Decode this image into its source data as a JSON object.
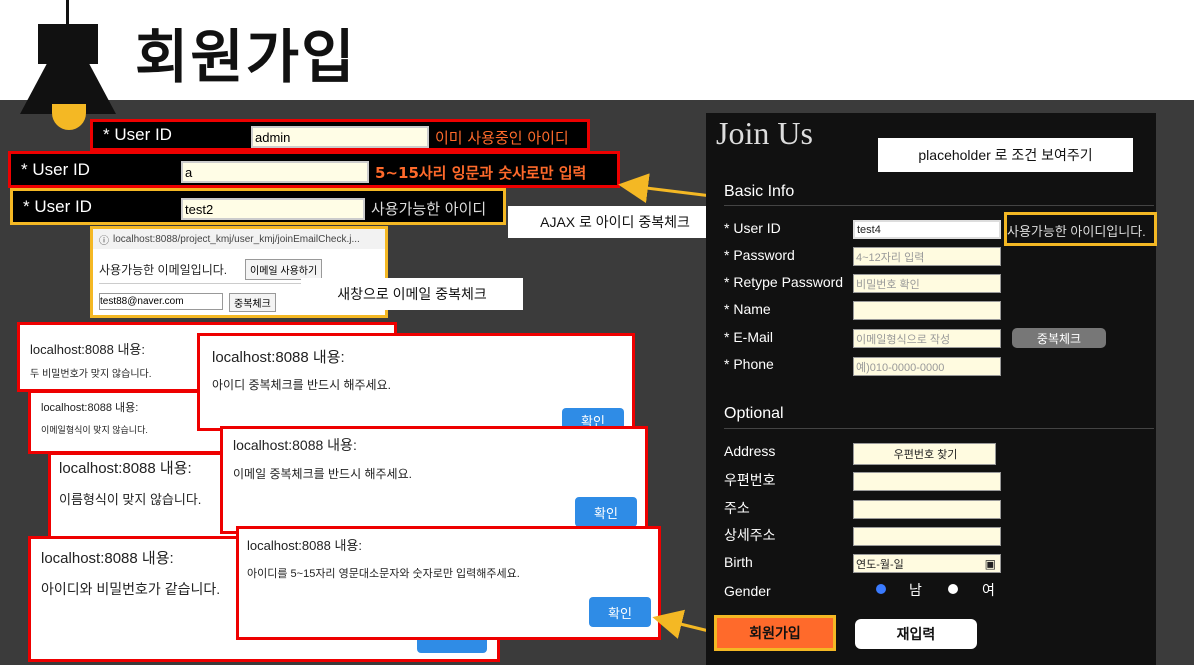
{
  "header": {
    "title": "회원가입"
  },
  "id_examples": [
    {
      "label": "* User ID",
      "value": "admin",
      "message": "이미 사용중인 아이디"
    },
    {
      "label": "* User ID",
      "value": "a",
      "message": "5~15사리 잉문과 숫사로만 입력"
    },
    {
      "label": "* User ID",
      "value": "test2",
      "message": "사용가능한 아이디"
    }
  ],
  "email_window": {
    "url": "localhost:8088/project_kmj/user_kmj/joinEmailCheck.j...",
    "status": "사용가능한 이메일입니다.",
    "use_button": "이메일 사용하기",
    "email_value": "test88@naver.com",
    "check_button": "중복체크"
  },
  "callouts": {
    "email_popup": "새창으로 이메일 중복체크",
    "ajax": "AJAX 로 아이디 중복체크",
    "placeholder": "placeholder 로 조건 보여주기"
  },
  "popups": [
    {
      "title": "localhost:8088 내용:",
      "message": "두 비밀번호가 맞지 않습니다."
    },
    {
      "title": "localhost:8088 내용:",
      "message": "이메일형식이 맞지 않습니다."
    },
    {
      "title": "localhost:8088 내용:",
      "message": "아이디 중복체크를 반드시 해주세요.",
      "ok": "확인"
    },
    {
      "title": "localhost:8088 내용:",
      "message": "이메일 중복체크를 반드시 해주세요.",
      "ok": "확인"
    },
    {
      "title": "localhost:8088 내용:",
      "message": "이름형식이 맞지 않습니다."
    },
    {
      "title": "localhost:8088 내용:",
      "message": "아이디와 비밀번호가 같습니다."
    },
    {
      "title": "localhost:8088 내용:",
      "message": "아이디를 5~15자리 영문대소문자와 숫자로만 입력해주세요.",
      "ok": "확인"
    }
  ],
  "form": {
    "heading": "Join Us",
    "basic_info": "Basic Info",
    "userid_label": "* User ID",
    "userid_value": "test4",
    "userid_message": "사용가능한 아이디입니다.",
    "password_label": "* Password",
    "password_placeholder": "4~12자리 입력",
    "retype_label": "* Retype Password",
    "retype_placeholder": "비밀번호 확인",
    "name_label": "* Name",
    "email_label": "* E-Mail",
    "email_placeholder": "이메일형식으로 작성",
    "email_check": "중복체크",
    "phone_label": "* Phone",
    "phone_placeholder": "예)010-0000-0000",
    "optional": "Optional",
    "address_label": "Address",
    "zip_button": "우편번호 찾기",
    "zip_label": "우편번호",
    "addr_label": "주소",
    "detail_label": "상세주소",
    "birth_label": "Birth",
    "birth_placeholder": "연도-월-일",
    "gender_label": "Gender",
    "male": "남",
    "female": "여",
    "submit": "회원가입",
    "reset": "재입력"
  },
  "colors": {
    "highlight": "#f4b824",
    "error": "#e00000"
  }
}
